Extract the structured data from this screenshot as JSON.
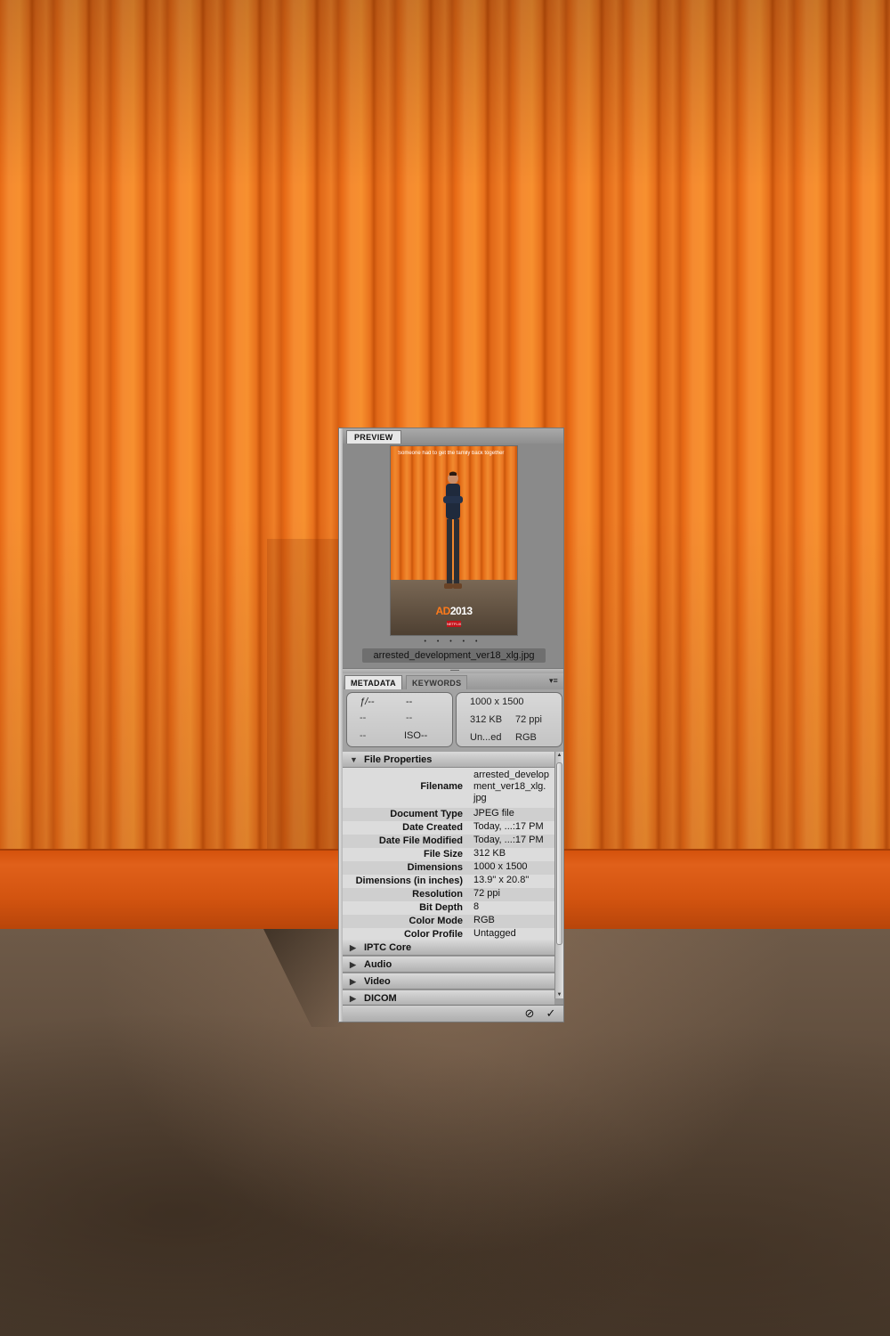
{
  "preview_tab": "PREVIEW",
  "thumbnail": {
    "tagline": "Someone had to get the family back together",
    "logo_ad": "AD",
    "logo_year": "2013",
    "netflix": "NETFLIX"
  },
  "pager_dots": "• • • • •",
  "filename_label": "arrested_development_ver18_xlg.jpg",
  "tabs": {
    "metadata": "METADATA",
    "keywords": "KEYWORDS",
    "menu_icon": "▾≡"
  },
  "summary": {
    "left": {
      "fstop": "ƒ/--",
      "shutter": "--",
      "r2c1": "--",
      "r2c2": "--",
      "r3c1": "--",
      "iso": "ISO--"
    },
    "right": {
      "dimensions": "1000 x 1500",
      "size": "312 KB",
      "resolution": "72 ppi",
      "profile": "Un...ed",
      "mode": "RGB"
    }
  },
  "file_properties": {
    "header": "File Properties",
    "rows": [
      {
        "key": "Filename",
        "value_lines": [
          "arrested_develop",
          "ment_ver18_xlg.",
          "jpg"
        ]
      },
      {
        "key": "Document Type",
        "value": "JPEG file"
      },
      {
        "key": "Date Created",
        "value": "Today, ...:17 PM"
      },
      {
        "key": "Date File Modified",
        "value": "Today, ...:17 PM"
      },
      {
        "key": "File Size",
        "value": "312 KB"
      },
      {
        "key": "Dimensions",
        "value": "1000 x 1500"
      },
      {
        "key": "Dimensions (in inches)",
        "value": "13.9\" x 20.8\""
      },
      {
        "key": "Resolution",
        "value": "72 ppi"
      },
      {
        "key": "Bit Depth",
        "value": "8"
      },
      {
        "key": "Color Mode",
        "value": "RGB"
      },
      {
        "key": "Color Profile",
        "value": "Untagged"
      }
    ]
  },
  "sections": [
    "IPTC Core",
    "Audio",
    "Video",
    "DICOM"
  ],
  "footer": {
    "cancel_icon": "⊘",
    "apply_icon": "✓"
  },
  "colors": {
    "accent_orange": "#f08a2e",
    "panel_gray": "#9a9a9a"
  }
}
